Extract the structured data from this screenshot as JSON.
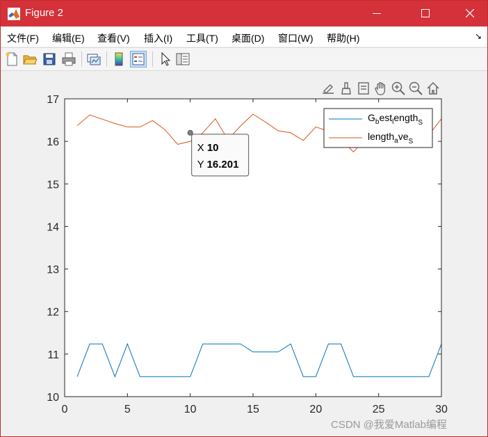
{
  "window": {
    "title": "Figure 2"
  },
  "menu": {
    "items": [
      "文件(F)",
      "编辑(E)",
      "查看(V)",
      "插入(I)",
      "工具(T)",
      "桌面(D)",
      "窗口(W)",
      "帮助(H)"
    ],
    "overflow_arrow": "↘"
  },
  "toolbar": {
    "icons": [
      "new-figure-icon",
      "open-icon",
      "save-icon",
      "print-icon",
      "link-plot-icon",
      "colorbar-icon",
      "legend-icon",
      "pointer-icon",
      "property-inspector-icon"
    ],
    "active": "legend-icon"
  },
  "axes_toolbar": {
    "icons": [
      "export-icon",
      "brush-icon",
      "data-tips-icon",
      "pan-icon",
      "zoom-in-icon",
      "zoom-out-icon",
      "home-icon"
    ]
  },
  "chart_data": {
    "type": "line",
    "xlim": [
      0,
      30
    ],
    "ylim": [
      10,
      17
    ],
    "xticks": [
      0,
      5,
      10,
      15,
      20,
      25,
      30
    ],
    "yticks": [
      10,
      11,
      12,
      13,
      14,
      15,
      16,
      17
    ],
    "grid": false,
    "legend_position": "top-right",
    "x": [
      1,
      2,
      3,
      4,
      5,
      6,
      7,
      8,
      9,
      10,
      11,
      12,
      13,
      14,
      15,
      16,
      17,
      18,
      19,
      20,
      21,
      22,
      23,
      24,
      25,
      26,
      27,
      28,
      29,
      30
    ],
    "series": [
      {
        "name_main": "G",
        "name_parts": [
          "G",
          "b",
          "est",
          "l",
          "ength",
          "S"
        ],
        "color": "#0072BD",
        "values": [
          10.47,
          11.24,
          11.24,
          10.47,
          11.24,
          10.47,
          10.47,
          10.47,
          10.47,
          10.47,
          11.24,
          11.24,
          11.24,
          11.24,
          11.05,
          11.05,
          11.05,
          11.24,
          10.47,
          10.47,
          11.24,
          11.24,
          10.47,
          10.47,
          10.47,
          10.47,
          10.47,
          10.47,
          10.47,
          11.24
        ]
      },
      {
        "name_parts": [
          "length",
          "a",
          "ve",
          "S"
        ],
        "color": "#D95319",
        "values": [
          16.37,
          16.62,
          16.52,
          16.42,
          16.34,
          16.34,
          16.49,
          16.27,
          15.93,
          16.0,
          16.2,
          16.53,
          16.04,
          16.36,
          16.64,
          16.45,
          16.25,
          16.2,
          16.02,
          16.34,
          16.24,
          16.05,
          15.75,
          16.08,
          16.2,
          16.3,
          16.1,
          16.12,
          16.15,
          16.53
        ]
      }
    ],
    "datatip": {
      "x_label": "X",
      "x_value": "10",
      "y_label": "Y",
      "y_value": "16.201",
      "x": 10,
      "y": 16.201
    }
  },
  "watermark": "CSDN @我爱Matlab编程"
}
